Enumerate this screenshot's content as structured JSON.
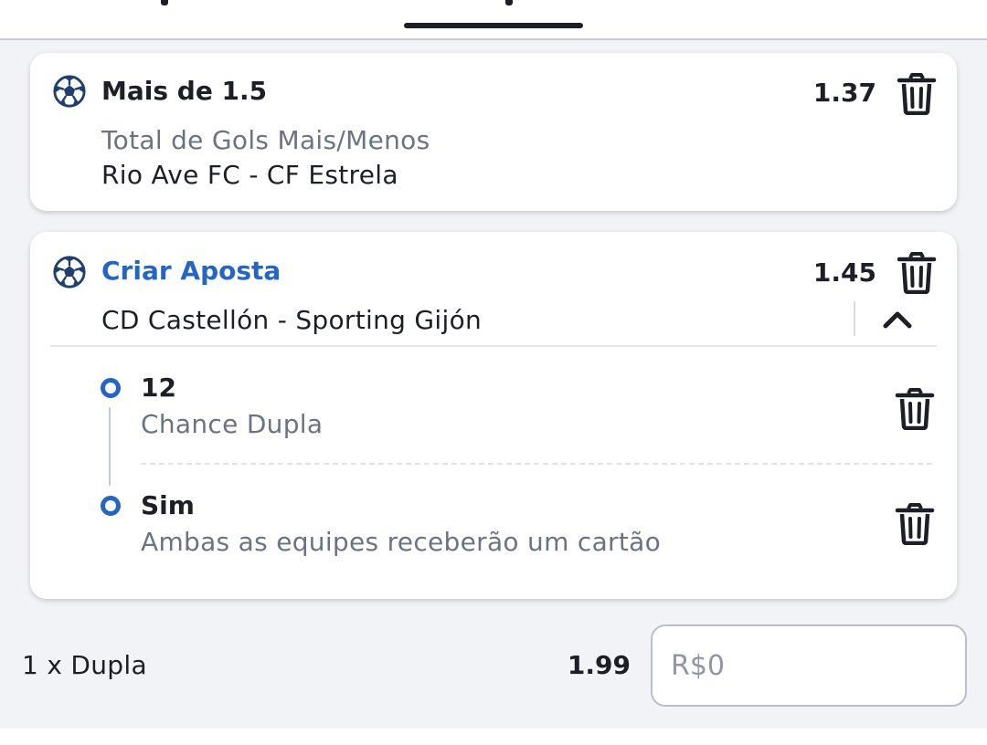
{
  "colors": {
    "accent": "#2566c4",
    "text": "#1c1f26",
    "muted": "#6b7382",
    "background": "#f2f3f6"
  },
  "selections": [
    {
      "title": "Mais de 1.5",
      "market": "Total de Gols Mais/Menos",
      "event": "Rio Ave FC - CF Estrela",
      "odds": "1.37",
      "icon": "soccer-ball-icon"
    }
  ],
  "bet_builder": {
    "title": "Criar Aposta",
    "odds": "1.45",
    "event": "CD Castellón - Sporting Gijón",
    "legs": [
      {
        "title": "12",
        "market": "Chance Dupla"
      },
      {
        "title": "Sim",
        "market": "Ambas as equipes receberão um cartão"
      }
    ]
  },
  "footer": {
    "bet_type": "1 x Dupla",
    "total_odds": "1.99",
    "stake_placeholder": "R$0"
  }
}
